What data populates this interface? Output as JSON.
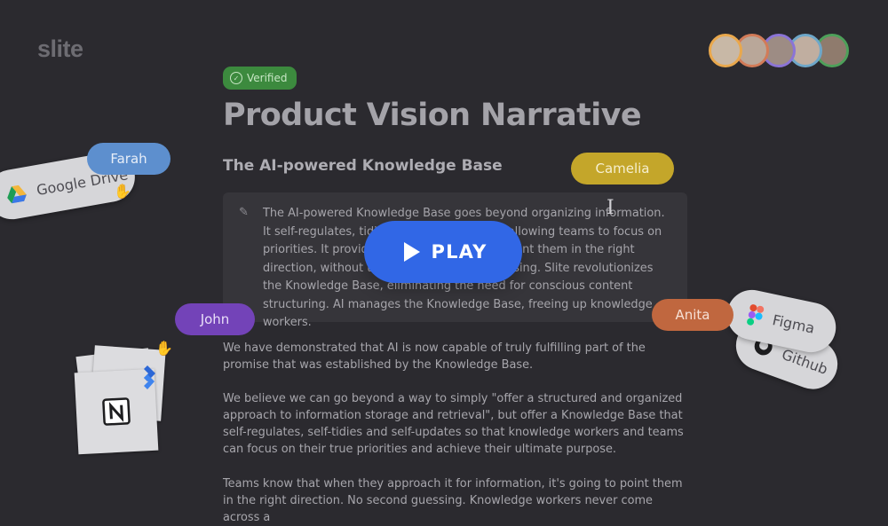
{
  "brand": {
    "logo_text": "slite"
  },
  "collaborators": [
    {
      "initial": "",
      "ring": "#e9a84d",
      "fill": "#c8b8a6"
    },
    {
      "initial": "",
      "ring": "#d27b58",
      "fill": "#b9a799"
    },
    {
      "initial": "",
      "ring": "#8b74d6",
      "fill": "#9d8c84"
    },
    {
      "initial": "",
      "ring": "#6ea7c9",
      "fill": "#c0aea0"
    },
    {
      "initial": "",
      "ring": "#4ea05a",
      "fill": "#8f7b6d"
    }
  ],
  "doc": {
    "badge": "Verified",
    "title": "Product Vision Narrative",
    "subtitle": "The AI-powered Knowledge Base",
    "callout": "The AI-powered Knowledge Base goes beyond organizing information. It self-regulates, tidies itself, and updates, allowing teams to focus on priorities. It provides accurate answers to point them in the right direction, without the need for second-guessing. Slite revolutionizes the Knowledge Base, eliminating the need for conscious content structuring. AI manages the Knowledge Base, freeing up knowledge workers.",
    "paragraphs": [
      "We have demonstrated that AI is now capable of truly fulfilling part of the promise that was established by the Knowledge Base.",
      "We believe we can go beyond a way to simply \"offer a structured and organized approach to information storage and retrieval\", but offer a Knowledge Base that self-regulates, self-tidies and self-updates so that knowledge workers and teams can focus on their true priorities and achieve their ultimate purpose.",
      "Teams know that when they approach it for information, it's going to point them in the right direction. No second guessing. Knowledge workers never come across a"
    ]
  },
  "play_button": {
    "label": "PLAY"
  },
  "users": [
    {
      "name": "Farah",
      "color": "#5d8fce",
      "text": "#e7eef8"
    },
    {
      "name": "Camelia",
      "color": "#c4a62a",
      "text": "#f6efcf"
    },
    {
      "name": "John",
      "color": "#7343b8",
      "text": "#e9dff8"
    },
    {
      "name": "Anita",
      "color": "#c0673f",
      "text": "#f6e0d5"
    }
  ],
  "integrations": {
    "google_drive": "Google Drive",
    "figma": "Figma",
    "github": "Github"
  }
}
